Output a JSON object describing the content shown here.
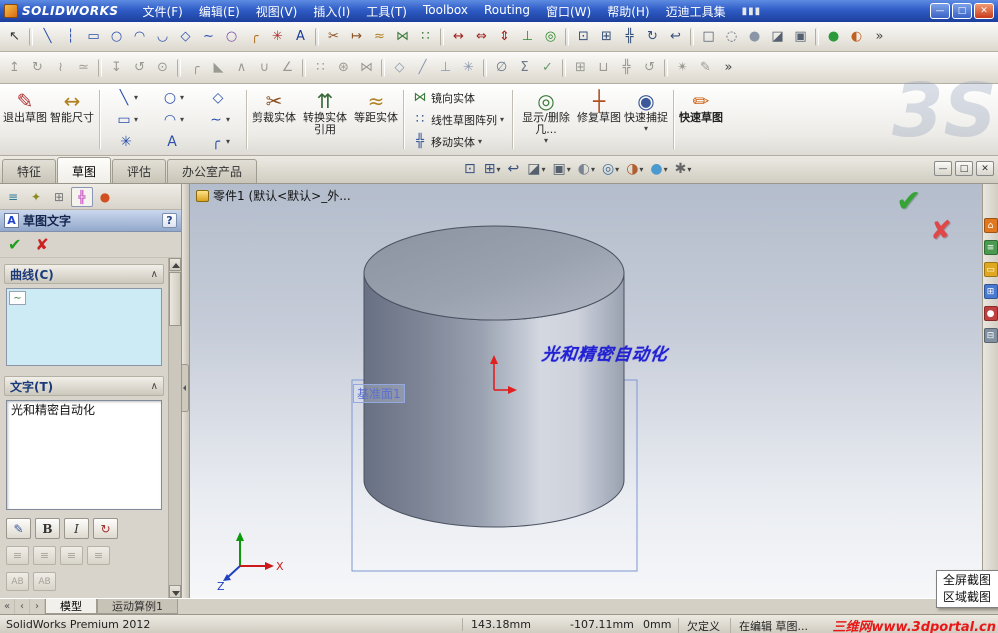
{
  "titlebar": {
    "logo": "SOLIDWORKS",
    "menus": [
      "文件(F)",
      "编辑(E)",
      "视图(V)",
      "插入(I)",
      "工具(T)",
      "Toolbox",
      "Routing",
      "窗口(W)",
      "帮助(H)",
      "迈迪工具集"
    ],
    "window": {
      "minimize": "—",
      "maximize": "□",
      "close": "✕"
    }
  },
  "toolbar1": {
    "icons": [
      {
        "name": "select-icon",
        "glyph": "↖",
        "style": "color:#333"
      },
      {
        "name": "separator",
        "glyph": "",
        "inter": "false"
      },
      {
        "name": "line-icon",
        "glyph": "╲",
        "style": "color:#2a4fae"
      },
      {
        "name": "centerline-icon",
        "glyph": "┆",
        "style": "color:#2a4fae"
      },
      {
        "name": "rectangle-icon",
        "glyph": "▭",
        "style": "color:#2a4fae"
      },
      {
        "name": "circle-icon",
        "glyph": "○",
        "style": "color:#2a4fae"
      },
      {
        "name": "arc-icon",
        "glyph": "◠",
        "style": "color:#2a4fae"
      },
      {
        "name": "tangent-arc-icon",
        "glyph": "◡",
        "style": "color:#2a4fae"
      },
      {
        "name": "polygon-icon",
        "glyph": "◇",
        "style": "color:#2a4fae"
      },
      {
        "name": "spline-icon",
        "glyph": "∼",
        "style": "color:#2a4fae"
      },
      {
        "name": "ellipse-icon",
        "glyph": "○",
        "style": "color:#7a4fae"
      },
      {
        "name": "sketch-fillet-icon",
        "glyph": "╭",
        "style": "color:#b07020"
      },
      {
        "name": "point-icon",
        "glyph": "✳",
        "style": "color:#b03030"
      },
      {
        "name": "text-icon",
        "glyph": "A",
        "style": "color:#1a3a9e"
      },
      {
        "name": "separator",
        "glyph": "",
        "inter": "false"
      },
      {
        "name": "trim-entities-icon",
        "glyph": "✂",
        "style": "color:#8a5020"
      },
      {
        "name": "extend-entities-icon",
        "glyph": "↦",
        "style": "color:#8a5020"
      },
      {
        "name": "offset-entities-icon",
        "glyph": "≈",
        "style": "color:#b08020"
      },
      {
        "name": "mirror-entities-icon",
        "glyph": "⋈",
        "style": "color:#3a7a3a"
      },
      {
        "name": "linear-sketch-pattern-icon",
        "glyph": "∷",
        "style": "color:#3a7a3a"
      },
      {
        "name": "separator",
        "glyph": "",
        "inter": "false"
      },
      {
        "name": "smart-dimension-icon",
        "glyph": "↔",
        "style": "color:#a02020"
      },
      {
        "name": "horizontal-dimension-icon",
        "glyph": "⇔",
        "style": "color:#a02020"
      },
      {
        "name": "vertical-dimension-icon",
        "glyph": "⇕",
        "style": "color:#a02020"
      },
      {
        "name": "add-relation-icon",
        "glyph": "⊥",
        "style": "color:#2a8a2a"
      },
      {
        "name": "display-relations-icon",
        "glyph": "◎",
        "style": "color:#2a8a2a"
      },
      {
        "name": "separator",
        "glyph": "",
        "inter": "false"
      },
      {
        "name": "zoom-fit-icon",
        "glyph": "⊡",
        "style": "color:#35507a"
      },
      {
        "name": "zoom-area-icon",
        "glyph": "⊞",
        "style": "color:#35507a"
      },
      {
        "name": "pan-icon",
        "glyph": "╬",
        "style": "color:#35507a"
      },
      {
        "name": "rotate-view-icon",
        "glyph": "↻",
        "style": "color:#35507a"
      },
      {
        "name": "previous-view-icon",
        "glyph": "↩",
        "style": "color:#35507a"
      },
      {
        "name": "separator",
        "glyph": "",
        "inter": "false"
      },
      {
        "name": "wireframe-icon",
        "glyph": "□",
        "style": "color:#556070"
      },
      {
        "name": "hidden-lines-icon",
        "glyph": "◌",
        "style": "color:#556070"
      },
      {
        "name": "shaded-icon",
        "glyph": "●",
        "style": "color:#8a96a6"
      },
      {
        "name": "section-view-icon",
        "glyph": "◪",
        "style": "color:#556070"
      },
      {
        "name": "view-orientation-icon",
        "glyph": "▣",
        "style": "color:#556070"
      },
      {
        "name": "separator",
        "glyph": "",
        "inter": "false"
      },
      {
        "name": "apply-scene-icon",
        "glyph": "●",
        "style": "color:#2a9a3a"
      },
      {
        "name": "edit-appearance-icon",
        "glyph": "◐",
        "style": "color:#c06020"
      },
      {
        "name": "toolbar-options-icon",
        "glyph": "»",
        "style": "color:#444"
      }
    ]
  },
  "toolbar2": {
    "icons": [
      {
        "name": "extruded-boss-icon",
        "glyph": "↥",
        "style": "color:#9a9a92"
      },
      {
        "name": "revolved-boss-icon",
        "glyph": "↻",
        "style": "color:#9a9a92"
      },
      {
        "name": "swept-boss-icon",
        "glyph": "≀",
        "style": "color:#9a9a92"
      },
      {
        "name": "lofted-boss-icon",
        "glyph": "≃",
        "style": "color:#9a9a92"
      },
      {
        "name": "separator",
        "glyph": "",
        "inter": "false"
      },
      {
        "name": "extruded-cut-icon",
        "glyph": "↧",
        "style": "color:#9a9a92"
      },
      {
        "name": "revolved-cut-icon",
        "glyph": "↺",
        "style": "color:#9a9a92"
      },
      {
        "name": "hole-wizard-icon",
        "glyph": "⊙",
        "style": "color:#9a9a92"
      },
      {
        "name": "separator",
        "glyph": "",
        "inter": "false"
      },
      {
        "name": "fillet-icon",
        "glyph": "╭",
        "style": "color:#9a9a92"
      },
      {
        "name": "chamfer-icon",
        "glyph": "◣",
        "style": "color:#9a9a92"
      },
      {
        "name": "rib-icon",
        "glyph": "∧",
        "style": "color:#9a9a92"
      },
      {
        "name": "shell-icon",
        "glyph": "∪",
        "style": "color:#9a9a92"
      },
      {
        "name": "draft-icon",
        "glyph": "∠",
        "style": "color:#9a9a92"
      },
      {
        "name": "separator",
        "glyph": "",
        "inter": "false"
      },
      {
        "name": "linear-pattern-icon",
        "glyph": "∷",
        "style": "color:#9a9a92"
      },
      {
        "name": "circular-pattern-icon",
        "glyph": "⊛",
        "style": "color:#9a9a92"
      },
      {
        "name": "mirror-feature-icon",
        "glyph": "⋈",
        "style": "color:#9a9a92"
      },
      {
        "name": "separator",
        "glyph": "",
        "inter": "false"
      },
      {
        "name": "reference-plane-icon",
        "glyph": "◇",
        "style": "color:#8a96b0"
      },
      {
        "name": "reference-axis-icon",
        "glyph": "╱",
        "style": "color:#8a96b0"
      },
      {
        "name": "coordinate-system-icon",
        "glyph": "⊥",
        "style": "color:#8a96b0"
      },
      {
        "name": "reference-point-icon",
        "glyph": "✳",
        "style": "color:#8a96b0"
      },
      {
        "name": "separator",
        "glyph": "",
        "inter": "false"
      },
      {
        "name": "measure-icon",
        "glyph": "∅",
        "style": "color:#6a7a8a"
      },
      {
        "name": "mass-properties-icon",
        "glyph": "Σ",
        "style": "color:#6a7a8a"
      },
      {
        "name": "check-icon",
        "glyph": "✓",
        "style": "color:#6a9a6a"
      },
      {
        "name": "separator",
        "glyph": "",
        "inter": "false"
      },
      {
        "name": "insert-components-icon",
        "glyph": "⊞",
        "style": "color:#9a9a92"
      },
      {
        "name": "mate-icon",
        "glyph": "⊔",
        "style": "color:#9a9a92"
      },
      {
        "name": "move-component-icon",
        "glyph": "╬",
        "style": "color:#9a9a92"
      },
      {
        "name": "rotate-component-icon",
        "glyph": "↺",
        "style": "color:#9a9a92"
      },
      {
        "name": "separator",
        "glyph": "",
        "inter": "false"
      },
      {
        "name": "exploded-view-icon",
        "glyph": "✴",
        "style": "color:#9a9a92"
      },
      {
        "name": "edit-component-icon",
        "glyph": "✎",
        "style": "color:#9a9a92"
      },
      {
        "name": "toolbar-options-icon",
        "glyph": "»",
        "style": "color:#444"
      }
    ]
  },
  "command_manager": {
    "buttons": {
      "exit_sketch": "退出草图",
      "smart_dimension": "智能尺寸",
      "trim": "剪裁实体",
      "convert": "转换实体引用",
      "offset": "等距实体",
      "mirror": "镜向实体",
      "linear_pattern": "线性草图阵列",
      "move": "移动实体",
      "display_delete": "显示/删除几...",
      "repair": "修复草图",
      "quick_snap": "快速捕捉",
      "rapid_sketch": "快速草图"
    },
    "icons": {
      "exit_sketch": "✎",
      "smart_dimension": "↔",
      "trim": "✂",
      "convert": "⇈",
      "offset": "≈",
      "mirror": "⋈",
      "linear_pattern": "∷",
      "move": "╬",
      "display_delete": "◎",
      "repair": "┼",
      "quick_snap": "◉",
      "rapid_sketch": "✏",
      "dropdown": "▾"
    },
    "entities": [
      {
        "name": "line-tool",
        "glyph": "╲",
        "arrow": "▾"
      },
      {
        "name": "circle-tool",
        "glyph": "○",
        "arrow": "▾"
      },
      {
        "name": "polygon-tool",
        "glyph": "◇",
        "arrow": ""
      },
      {
        "name": "rectangle-tool",
        "glyph": "▭",
        "arrow": "▾"
      },
      {
        "name": "arc-tool",
        "glyph": "◠",
        "arrow": "▾"
      },
      {
        "name": "spline-tool",
        "glyph": "∼",
        "arrow": "▾"
      },
      {
        "name": "point-tool",
        "glyph": "✳",
        "arrow": ""
      },
      {
        "name": "text-tool",
        "glyph": "A",
        "arrow": ""
      },
      {
        "name": "fillet-tool",
        "glyph": "╭",
        "arrow": "▾"
      }
    ]
  },
  "ribbon_tabs": [
    {
      "name": "tab-features",
      "label": "特征",
      "active": "false"
    },
    {
      "name": "tab-sketch",
      "label": "草图",
      "active": "true"
    },
    {
      "name": "tab-evaluate",
      "label": "评估",
      "active": "false"
    },
    {
      "name": "tab-office-products",
      "label": "办公室产品",
      "active": "false"
    }
  ],
  "headsup": {
    "icons": [
      {
        "name": "zoom-fit-icon",
        "glyph": "⊡",
        "arrow": "",
        "style": "color:#38507e"
      },
      {
        "name": "zoom-area-icon",
        "glyph": "⊞",
        "arrow": "▾",
        "style": "color:#38507e"
      },
      {
        "name": "previous-view-icon",
        "glyph": "↩",
        "arrow": "",
        "style": "color:#38507e"
      },
      {
        "name": "section-view-icon",
        "glyph": "◪",
        "arrow": "▾",
        "style": "color:#55606e"
      },
      {
        "name": "view-orientation-icon",
        "glyph": "▣",
        "arrow": "▾",
        "style": "color:#55606e"
      },
      {
        "name": "display-style-icon",
        "glyph": "◐",
        "arrow": "▾",
        "style": "color:#7a8494"
      },
      {
        "name": "hide-show-items-icon",
        "glyph": "◎",
        "arrow": "▾",
        "style": "color:#3c6ea5"
      },
      {
        "name": "edit-appearance-icon",
        "glyph": "◑",
        "arrow": "▾",
        "style": "color:#b06030"
      },
      {
        "name": "apply-scene-icon",
        "glyph": "●",
        "arrow": "▾",
        "style": "color:#4a9ad0"
      },
      {
        "name": "view-settings-icon",
        "glyph": "✱",
        "arrow": "▾",
        "style": "color:#666"
      }
    ]
  },
  "docwin": {
    "minimize": "—",
    "restore": "□",
    "close": "✕"
  },
  "tree": {
    "root": "零件1 (默认<默认>_外..."
  },
  "property_manager": {
    "tabs": [
      {
        "name": "featuremanager-tab",
        "glyph": "≡",
        "style": "color:#2a7a9a",
        "active": "false"
      },
      {
        "name": "propertymanager-tab",
        "glyph": "✦",
        "style": "color:#8a8a20",
        "active": "false"
      },
      {
        "name": "configurationmanager-tab",
        "glyph": "⊞",
        "style": "color:#777777",
        "active": "false"
      },
      {
        "name": "dimxpertmanager-tab",
        "glyph": "╬",
        "style": "color:#c030c0",
        "active": "true"
      },
      {
        "name": "displaymanager-tab",
        "glyph": "●",
        "style": "color:#d05020",
        "active": "false"
      }
    ],
    "title": "草图文字",
    "title_icon": "A",
    "help": "?",
    "ok": "✔",
    "cancel": "✘",
    "collapse": "∧",
    "curve_label": "曲线(C)",
    "curve_box_icon": "∼",
    "text_label": "文字(T)",
    "text_value": "光和精密自动化",
    "font_button": "✎",
    "bold": "B",
    "italic": "I",
    "rotate": "↻",
    "align": [
      {
        "name": "align-left-button",
        "glyph": "≡"
      },
      {
        "name": "align-center-button",
        "glyph": "≡"
      },
      {
        "name": "align-right-button",
        "glyph": "≡"
      },
      {
        "name": "align-justify-button",
        "glyph": "≡"
      }
    ],
    "flip": [
      {
        "name": "flip-vertical-button",
        "glyph": "AB"
      },
      {
        "name": "flip-horizontal-button",
        "glyph": "AB"
      }
    ]
  },
  "viewport": {
    "sketch_text": "光和精密自动化",
    "plane_label": "基准面1",
    "confirm_ok": "✔",
    "confirm_cancel": "✘",
    "triad_x": "X",
    "triad_z": "Z",
    "ds_logo": "3S"
  },
  "taskpane": {
    "icons": [
      {
        "name": "home-icon",
        "glyph": "⌂",
        "style": "background:#e07820"
      },
      {
        "name": "design-library-icon",
        "glyph": "≡",
        "style": "background:#4a9a50"
      },
      {
        "name": "file-explorer-icon",
        "glyph": "▭",
        "style": "background:#e0a820"
      },
      {
        "name": "view-palette-icon",
        "glyph": "⊞",
        "style": "background:#4a7ad0"
      },
      {
        "name": "appearances-icon",
        "glyph": "●",
        "style": "background:#c04040"
      },
      {
        "name": "custom-properties-icon",
        "glyph": "⊟",
        "style": "background:#8090a0"
      }
    ]
  },
  "bottom": {
    "nav": [
      {
        "name": "tab-first-icon",
        "glyph": "«"
      },
      {
        "name": "tab-prev-icon",
        "glyph": "‹"
      },
      {
        "name": "tab-next-icon",
        "glyph": "›"
      }
    ],
    "tabs": [
      {
        "name": "tab-model",
        "label": "模型",
        "active": "true"
      },
      {
        "name": "tab-motion-study",
        "label": "运动算例1",
        "active": "false"
      }
    ]
  },
  "statusbar": {
    "product": "SolidWorks Premium 2012",
    "x": "143.18mm",
    "y": "-107.11mm",
    "z": "0mm",
    "state": "欠定义",
    "mode": "在编辑 草图...",
    "watermark": "三维网www.3dportal.cn"
  },
  "context_menu": {
    "items": [
      {
        "name": "fullscreen-capture-menu-item",
        "label": "全屏截图"
      },
      {
        "name": "region-capture-menu-item",
        "label": "区域截图"
      }
    ]
  }
}
